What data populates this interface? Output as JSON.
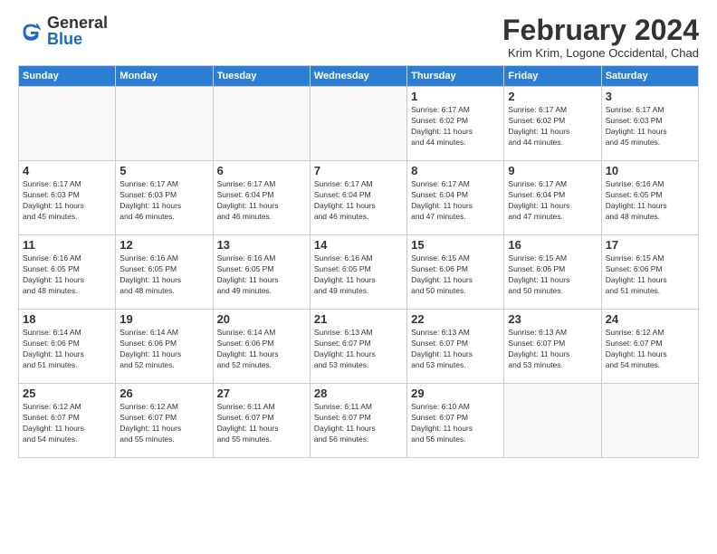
{
  "logo": {
    "general": "General",
    "blue": "Blue",
    "tagline": "GeneralBlue"
  },
  "header": {
    "month": "February 2024",
    "location": "Krim Krim, Logone Occidental, Chad"
  },
  "days_of_week": [
    "Sunday",
    "Monday",
    "Tuesday",
    "Wednesday",
    "Thursday",
    "Friday",
    "Saturday"
  ],
  "weeks": [
    [
      {
        "day": "",
        "info": ""
      },
      {
        "day": "",
        "info": ""
      },
      {
        "day": "",
        "info": ""
      },
      {
        "day": "",
        "info": ""
      },
      {
        "day": "1",
        "info": "Sunrise: 6:17 AM\nSunset: 6:02 PM\nDaylight: 11 hours\nand 44 minutes."
      },
      {
        "day": "2",
        "info": "Sunrise: 6:17 AM\nSunset: 6:02 PM\nDaylight: 11 hours\nand 44 minutes."
      },
      {
        "day": "3",
        "info": "Sunrise: 6:17 AM\nSunset: 6:03 PM\nDaylight: 11 hours\nand 45 minutes."
      }
    ],
    [
      {
        "day": "4",
        "info": "Sunrise: 6:17 AM\nSunset: 6:03 PM\nDaylight: 11 hours\nand 45 minutes."
      },
      {
        "day": "5",
        "info": "Sunrise: 6:17 AM\nSunset: 6:03 PM\nDaylight: 11 hours\nand 46 minutes."
      },
      {
        "day": "6",
        "info": "Sunrise: 6:17 AM\nSunset: 6:04 PM\nDaylight: 11 hours\nand 46 minutes."
      },
      {
        "day": "7",
        "info": "Sunrise: 6:17 AM\nSunset: 6:04 PM\nDaylight: 11 hours\nand 46 minutes."
      },
      {
        "day": "8",
        "info": "Sunrise: 6:17 AM\nSunset: 6:04 PM\nDaylight: 11 hours\nand 47 minutes."
      },
      {
        "day": "9",
        "info": "Sunrise: 6:17 AM\nSunset: 6:04 PM\nDaylight: 11 hours\nand 47 minutes."
      },
      {
        "day": "10",
        "info": "Sunrise: 6:16 AM\nSunset: 6:05 PM\nDaylight: 11 hours\nand 48 minutes."
      }
    ],
    [
      {
        "day": "11",
        "info": "Sunrise: 6:16 AM\nSunset: 6:05 PM\nDaylight: 11 hours\nand 48 minutes."
      },
      {
        "day": "12",
        "info": "Sunrise: 6:16 AM\nSunset: 6:05 PM\nDaylight: 11 hours\nand 48 minutes."
      },
      {
        "day": "13",
        "info": "Sunrise: 6:16 AM\nSunset: 6:05 PM\nDaylight: 11 hours\nand 49 minutes."
      },
      {
        "day": "14",
        "info": "Sunrise: 6:16 AM\nSunset: 6:05 PM\nDaylight: 11 hours\nand 49 minutes."
      },
      {
        "day": "15",
        "info": "Sunrise: 6:15 AM\nSunset: 6:06 PM\nDaylight: 11 hours\nand 50 minutes."
      },
      {
        "day": "16",
        "info": "Sunrise: 6:15 AM\nSunset: 6:06 PM\nDaylight: 11 hours\nand 50 minutes."
      },
      {
        "day": "17",
        "info": "Sunrise: 6:15 AM\nSunset: 6:06 PM\nDaylight: 11 hours\nand 51 minutes."
      }
    ],
    [
      {
        "day": "18",
        "info": "Sunrise: 6:14 AM\nSunset: 6:06 PM\nDaylight: 11 hours\nand 51 minutes."
      },
      {
        "day": "19",
        "info": "Sunrise: 6:14 AM\nSunset: 6:06 PM\nDaylight: 11 hours\nand 52 minutes."
      },
      {
        "day": "20",
        "info": "Sunrise: 6:14 AM\nSunset: 6:06 PM\nDaylight: 11 hours\nand 52 minutes."
      },
      {
        "day": "21",
        "info": "Sunrise: 6:13 AM\nSunset: 6:07 PM\nDaylight: 11 hours\nand 53 minutes."
      },
      {
        "day": "22",
        "info": "Sunrise: 6:13 AM\nSunset: 6:07 PM\nDaylight: 11 hours\nand 53 minutes."
      },
      {
        "day": "23",
        "info": "Sunrise: 6:13 AM\nSunset: 6:07 PM\nDaylight: 11 hours\nand 53 minutes."
      },
      {
        "day": "24",
        "info": "Sunrise: 6:12 AM\nSunset: 6:07 PM\nDaylight: 11 hours\nand 54 minutes."
      }
    ],
    [
      {
        "day": "25",
        "info": "Sunrise: 6:12 AM\nSunset: 6:07 PM\nDaylight: 11 hours\nand 54 minutes."
      },
      {
        "day": "26",
        "info": "Sunrise: 6:12 AM\nSunset: 6:07 PM\nDaylight: 11 hours\nand 55 minutes."
      },
      {
        "day": "27",
        "info": "Sunrise: 6:11 AM\nSunset: 6:07 PM\nDaylight: 11 hours\nand 55 minutes."
      },
      {
        "day": "28",
        "info": "Sunrise: 6:11 AM\nSunset: 6:07 PM\nDaylight: 11 hours\nand 56 minutes."
      },
      {
        "day": "29",
        "info": "Sunrise: 6:10 AM\nSunset: 6:07 PM\nDaylight: 11 hours\nand 56 minutes."
      },
      {
        "day": "",
        "info": ""
      },
      {
        "day": "",
        "info": ""
      }
    ]
  ]
}
